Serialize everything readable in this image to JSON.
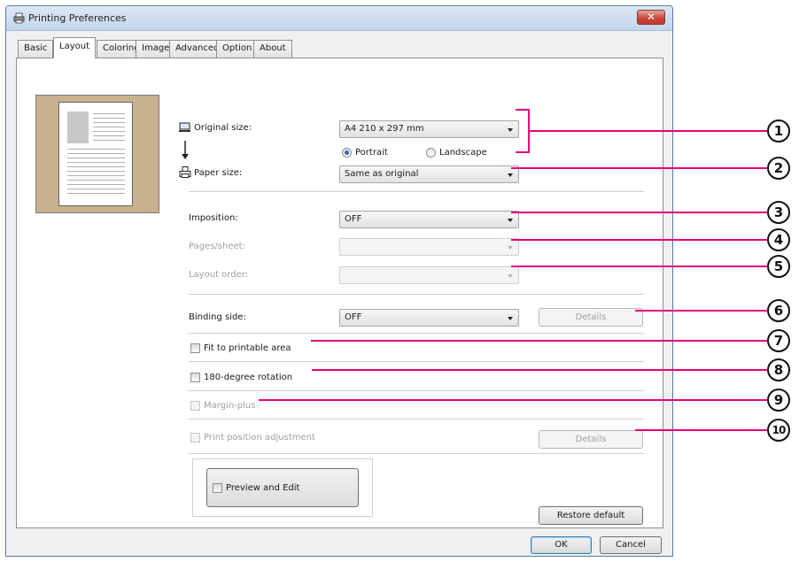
{
  "window": {
    "title": "Printing Preferences",
    "close_glyph": "✕"
  },
  "tabs": [
    {
      "label": "Basic"
    },
    {
      "label": "Layout"
    },
    {
      "label": "Coloring"
    },
    {
      "label": "Image"
    },
    {
      "label": "Advanced"
    },
    {
      "label": "Option"
    },
    {
      "label": "About"
    }
  ],
  "original_size": {
    "label": "Original size:",
    "value": "A4 210 x 297 mm",
    "icon": "monitor-icon"
  },
  "orientation": {
    "portrait": "Portrait",
    "landscape": "Landscape",
    "selected": "Portrait"
  },
  "paper_size": {
    "label": "Paper size:",
    "value": "Same as original",
    "icon": "printer-icon"
  },
  "imposition": {
    "label": "Imposition:",
    "value": "OFF"
  },
  "pages_sheet": {
    "label": "Pages/sheet:",
    "value": ""
  },
  "layout_order": {
    "label": "Layout order:",
    "value": ""
  },
  "binding_side": {
    "label": "Binding side:",
    "value": "OFF",
    "details": "Details"
  },
  "fit_printable": {
    "label": "Fit to printable area",
    "checked": false
  },
  "rotation": {
    "label": "180-degree rotation",
    "checked": false
  },
  "margin_plus": {
    "label": "Margin-plus",
    "checked": false
  },
  "print_position": {
    "label": "Print position adjustment",
    "details": "Details"
  },
  "preview_edit": {
    "label": "Preview and Edit",
    "checked": false
  },
  "buttons": {
    "restore": "Restore default",
    "ok": "OK",
    "cancel": "Cancel"
  },
  "callouts": [
    "1",
    "2",
    "3",
    "4",
    "5",
    "6",
    "7",
    "8",
    "9",
    "10"
  ],
  "colors": {
    "callout_line": "#e6007e",
    "preview_bg": "#c9b08e"
  }
}
